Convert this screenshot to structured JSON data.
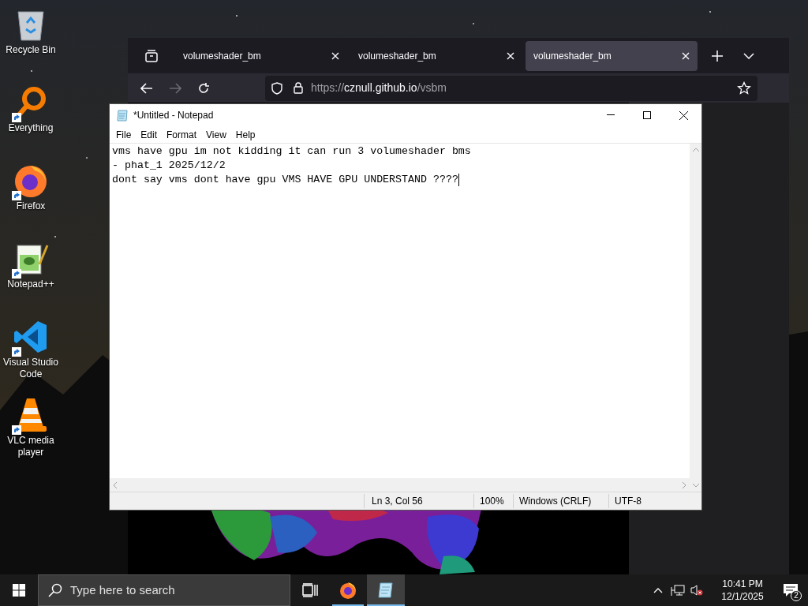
{
  "desktop_icons": [
    {
      "label": "Recycle Bin",
      "kind": "recycle-bin",
      "shortcut": false
    },
    {
      "label": "Everything",
      "kind": "magnifier",
      "shortcut": true
    },
    {
      "label": "Firefox",
      "kind": "firefox",
      "shortcut": true
    },
    {
      "label": "Notepad++",
      "kind": "notepadpp",
      "shortcut": true
    },
    {
      "label": "Visual Studio Code",
      "kind": "vscode",
      "shortcut": true
    },
    {
      "label": "VLC media player",
      "kind": "vlc",
      "shortcut": true
    }
  ],
  "browser": {
    "tabs": [
      {
        "title": "volumeshader_bm",
        "selected": false
      },
      {
        "title": "volumeshader_bm",
        "selected": false
      },
      {
        "title": "volumeshader_bm",
        "selected": true
      }
    ],
    "forward_disabled": true,
    "url": {
      "scheme": "https://",
      "host": "cznull.github.io",
      "path": "/vsbm"
    }
  },
  "notepad": {
    "title": "*Untitled - Notepad",
    "menu": [
      "File",
      "Edit",
      "Format",
      "View",
      "Help"
    ],
    "lines": [
      "vms have gpu im not kidding it can run 3 volumeshader bms",
      "- phat_1 2025/12/2",
      "dont say vms dont have gpu VMS HAVE GPU UNDERSTAND ????"
    ],
    "status": {
      "position": "Ln 3, Col 56",
      "zoom": "100%",
      "line_ending": "Windows (CRLF)",
      "encoding": "UTF-8"
    }
  },
  "taskbar": {
    "search_placeholder": "Type here to search",
    "apps": [
      {
        "kind": "task-view",
        "running": false,
        "selected": false
      },
      {
        "kind": "firefox",
        "running": true,
        "selected": false
      },
      {
        "kind": "notepad",
        "running": true,
        "selected": true
      }
    ],
    "time": "10:41 PM",
    "date": "12/1/2025",
    "notifications": "2"
  }
}
